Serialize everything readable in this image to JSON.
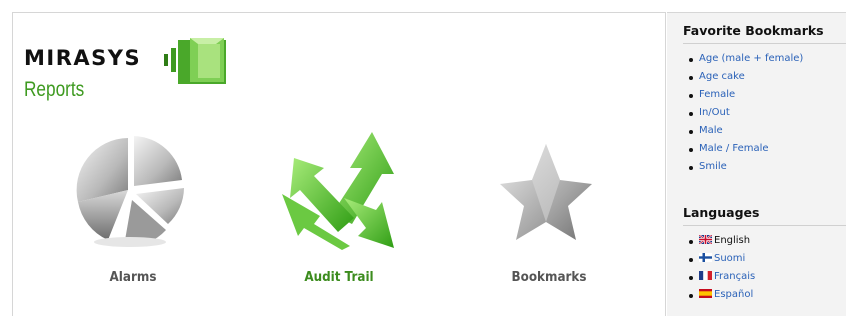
{
  "logo": {
    "name": "MIRASYS",
    "subtitle": "Reports"
  },
  "tiles": [
    {
      "label": "Alarms"
    },
    {
      "label": "Audit Trail"
    },
    {
      "label": "Bookmarks"
    }
  ],
  "favorites": {
    "heading": "Favorite Bookmarks",
    "items": [
      "Age (male + female)",
      "Age cake",
      "Female",
      "In/Out",
      "Male",
      "Male / Female",
      "Smile"
    ]
  },
  "languages": {
    "heading": "Languages",
    "items": [
      {
        "label": "English",
        "flag": "uk-flag-icon"
      },
      {
        "label": "Suomi",
        "flag": "finland-flag-icon"
      },
      {
        "label": "Français",
        "flag": "france-flag-icon"
      },
      {
        "label": "Español",
        "flag": "spain-flag-icon"
      }
    ]
  },
  "colors": {
    "brand_green": "#3e9a20",
    "link_blue": "#2b62b8",
    "sidebar_bg": "#f3f3f3"
  }
}
